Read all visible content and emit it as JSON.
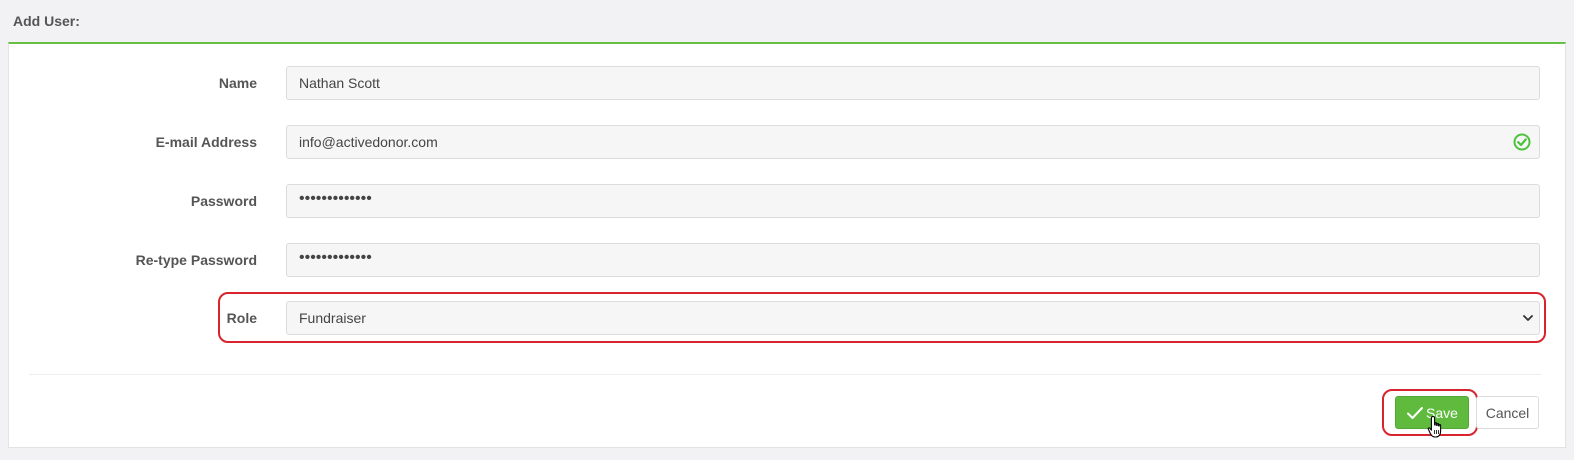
{
  "panel": {
    "title": "Add User:"
  },
  "form": {
    "name": {
      "label": "Name",
      "value": "Nathan Scott"
    },
    "email": {
      "label": "E-mail Address",
      "value": "info@activedonor.com",
      "status_icon": "check-circle-icon"
    },
    "password": {
      "label": "Password",
      "value": "•••••••••••••"
    },
    "retype_password": {
      "label": "Re-type Password",
      "value": "•••••••••••••"
    },
    "role": {
      "label": "Role",
      "selected": "Fundraiser"
    }
  },
  "actions": {
    "save_label": "Save",
    "cancel_label": "Cancel"
  },
  "colors": {
    "accent": "#67c046",
    "save_button": "#5fba3d",
    "highlight": "#d9232d",
    "valid_check": "#4cc33a"
  }
}
